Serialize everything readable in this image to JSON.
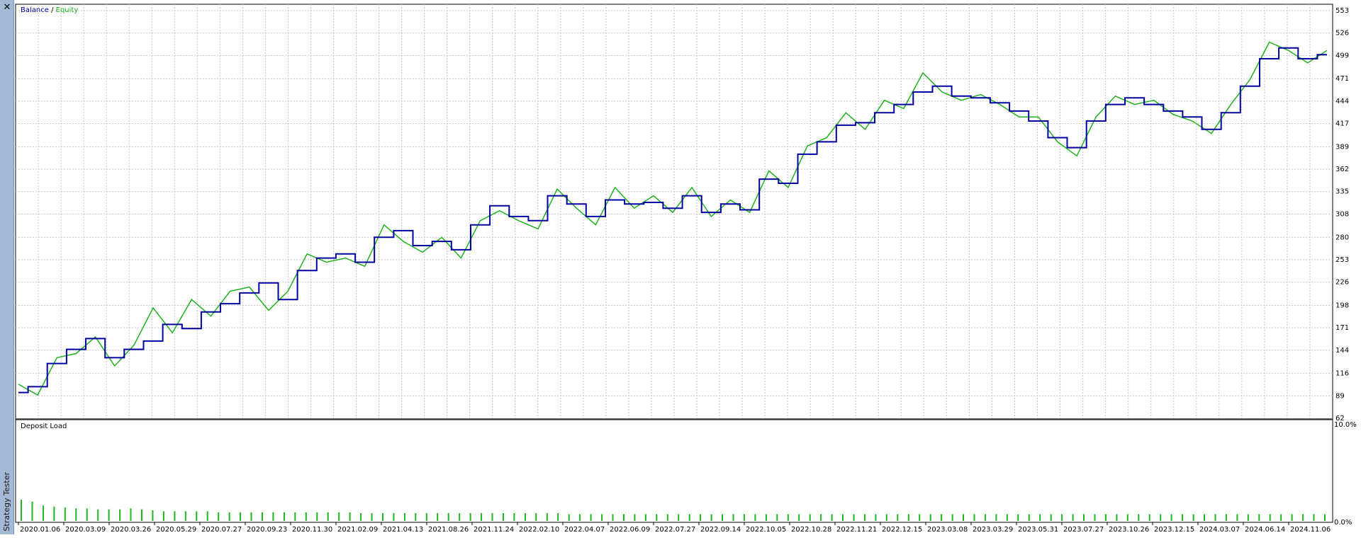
{
  "window": {
    "panel_name": "Strategy Tester",
    "close_glyph": "✕"
  },
  "colors": {
    "balance": "#0000a0",
    "equity": "#22b022",
    "deposit_bars": "#1fb51f",
    "grid": "#c8c8c8",
    "sidebar": "#a4b9d6"
  },
  "chart_data": [
    {
      "type": "line",
      "legend": {
        "balance_label": "Balance",
        "separator": " / ",
        "equity_label": "Equity",
        "position": "top-left"
      },
      "y_ticks": [
        553,
        526,
        499,
        471,
        444,
        417,
        389,
        362,
        335,
        308,
        280,
        253,
        226,
        198,
        171,
        144,
        116,
        89,
        62
      ],
      "ylim": [
        62,
        553
      ],
      "grid": true,
      "x_tick_labels": [
        "2020.01.06",
        "2020.03.09",
        "2020.03.26",
        "2020.05.29",
        "2020.07.27",
        "2020.09.23",
        "2020.11.30",
        "2021.02.09",
        "2021.04.13",
        "2021.08.26",
        "2021.11.24",
        "2022.02.10",
        "2022.04.07",
        "2022.06.09",
        "2022.07.27",
        "2022.09.14",
        "2022.10.05",
        "2022.10.28",
        "2022.11.21",
        "2022.12.15",
        "2023.03.08",
        "2023.03.29",
        "2023.05.31",
        "2023.07.27",
        "2023.10.26",
        "2023.12.15",
        "2024.03.07",
        "2024.06.14",
        "2024.11.06"
      ],
      "series": [
        {
          "name": "Balance",
          "values": [
            93,
            100,
            128,
            145,
            158,
            135,
            145,
            155,
            175,
            170,
            190,
            200,
            213,
            225,
            205,
            240,
            255,
            260,
            250,
            280,
            288,
            270,
            275,
            265,
            295,
            318,
            305,
            300,
            330,
            320,
            305,
            325,
            320,
            322,
            315,
            330,
            310,
            320,
            313,
            350,
            345,
            380,
            395,
            415,
            418,
            430,
            440,
            455,
            462,
            450,
            448,
            442,
            432,
            420,
            400,
            388,
            420,
            440,
            448,
            440,
            432,
            425,
            410,
            430,
            462,
            495,
            508,
            495,
            500
          ]
        },
        {
          "name": "Equity",
          "values": [
            103,
            90,
            135,
            140,
            160,
            125,
            150,
            195,
            165,
            205,
            185,
            215,
            220,
            192,
            215,
            260,
            250,
            255,
            245,
            295,
            275,
            262,
            280,
            255,
            300,
            312,
            300,
            290,
            338,
            315,
            295,
            340,
            315,
            330,
            310,
            340,
            305,
            325,
            310,
            360,
            340,
            390,
            400,
            430,
            410,
            445,
            435,
            478,
            455,
            445,
            452,
            440,
            425,
            425,
            395,
            378,
            425,
            450,
            440,
            445,
            428,
            420,
            405,
            440,
            470,
            515,
            505,
            490,
            505
          ]
        }
      ]
    },
    {
      "type": "bar",
      "title": "Deposit Load",
      "y_ticks": [
        "10.0%",
        "0.0%"
      ],
      "ylim": [
        0,
        10
      ],
      "series": [
        {
          "name": "Deposit Load",
          "values": [
            2.2,
            2.0,
            1.6,
            1.5,
            1.4,
            1.3,
            1.3,
            1.2,
            1.2,
            1.2,
            1.3,
            1.2,
            1.1,
            1.0,
            1.0,
            1.0,
            1.0,
            1.0,
            0.9,
            0.9,
            0.9,
            0.9,
            0.9,
            0.9,
            0.9,
            0.9,
            0.9,
            0.9,
            0.9,
            0.9,
            0.9,
            0.8,
            0.8,
            0.8,
            0.8,
            0.8,
            0.8,
            0.8,
            0.8,
            0.8,
            0.8,
            0.8,
            0.8,
            0.8,
            0.8,
            0.8,
            0.8,
            0.8,
            0.8,
            0.8,
            0.7,
            0.7,
            0.7,
            0.7,
            0.7,
            0.7,
            0.7,
            0.7,
            0.7,
            0.7,
            0.7,
            0.7,
            0.7,
            0.7,
            0.7,
            0.7,
            0.7,
            0.7,
            0.7,
            0.7,
            0.7,
            0.7,
            0.7,
            0.7,
            0.7,
            0.7,
            0.7,
            0.7,
            0.7,
            0.7,
            0.7,
            0.7,
            0.7,
            0.7,
            0.7,
            0.7,
            0.7,
            0.7,
            0.7,
            0.7,
            0.7,
            0.7,
            0.7,
            0.7,
            0.7,
            0.7,
            0.7,
            0.7,
            0.7,
            0.7,
            0.7,
            0.7,
            0.7,
            0.7,
            0.7,
            0.7,
            0.7,
            0.7,
            0.7,
            0.7,
            0.7,
            0.7,
            0.7,
            0.7,
            0.7,
            0.7,
            0.7,
            0.7,
            0.7,
            0.7
          ]
        }
      ]
    }
  ]
}
